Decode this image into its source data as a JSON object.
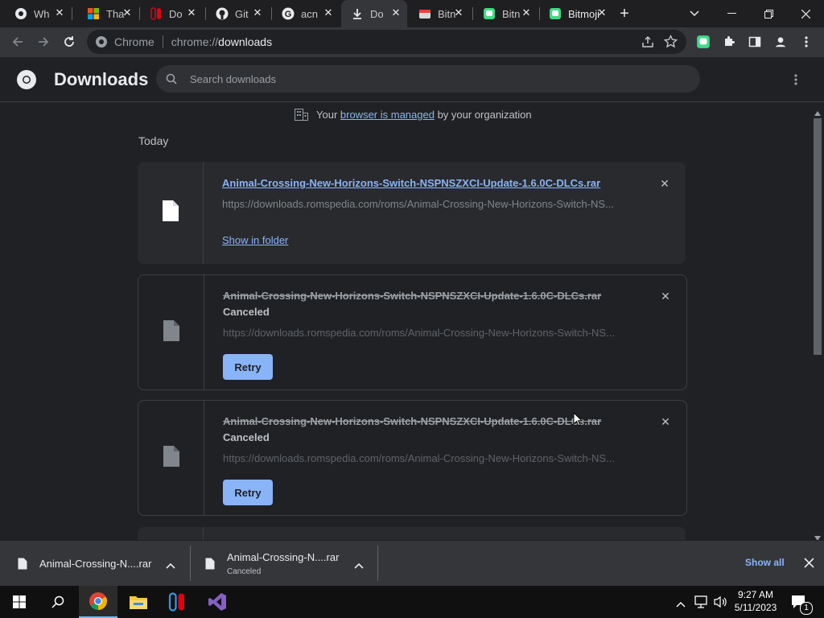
{
  "tabs": [
    {
      "title": "Wh",
      "icon": "chrome-icon"
    },
    {
      "title": "Tha",
      "icon": "microsoft-icon"
    },
    {
      "title": "Do",
      "icon": "nintendo-icon"
    },
    {
      "title": "Git",
      "icon": "github-icon"
    },
    {
      "title": "acn",
      "icon": "google-icon"
    },
    {
      "title": "Do",
      "icon": "download-icon"
    },
    {
      "title": "Bitn",
      "icon": "bitmoji-icon"
    },
    {
      "title": "Bitn",
      "icon": "bitmoji-icon"
    },
    {
      "title": "Bitmoji",
      "icon": "bitmoji-icon"
    }
  ],
  "address": {
    "prefix": "Chrome",
    "url_host": "chrome://",
    "url_path": "downloads"
  },
  "header": {
    "title": "Downloads",
    "search_placeholder": "Search downloads"
  },
  "managed": {
    "before": "Your ",
    "link": "browser is managed",
    "after": " by your organization"
  },
  "section_label": "Today",
  "downloads": [
    {
      "filename": "Animal-Crossing-New-Horizons-Switch-NSPNSZXCI-Update-1.6.0C-DLCs.rar",
      "url": "https://downloads.romspedia.com/roms/Animal-Crossing-New-Horizons-Switch-NS...",
      "action": "Show in folder"
    },
    {
      "filename": "Animal-Crossing-New-Horizons-Switch-NSPNSZXCI-Update-1.6.0C-DLCs.rar",
      "status": "Canceled",
      "url": "https://downloads.romspedia.com/roms/Animal-Crossing-New-Horizons-Switch-NS...",
      "action": "Retry"
    },
    {
      "filename": "Animal-Crossing-New-Horizons-Switch-NSPNSZXCI-Update-1.6.0C-DLCs.rar",
      "status": "Canceled",
      "url": "https://downloads.romspedia.com/roms/Animal-Crossing-New-Horizons-Switch-NS...",
      "action": "Retry"
    }
  ],
  "shelf": {
    "items": [
      {
        "name": "Animal-Crossing-N....rar"
      },
      {
        "name": "Animal-Crossing-N....rar",
        "status": "Canceled"
      }
    ],
    "show_all": "Show all"
  },
  "taskbar": {
    "time": "9:27 AM",
    "date": "5/11/2023",
    "notifications": "1"
  },
  "colors": {
    "accent": "#8ab4f8",
    "background": "#202124",
    "toolbar": "#35363a"
  }
}
